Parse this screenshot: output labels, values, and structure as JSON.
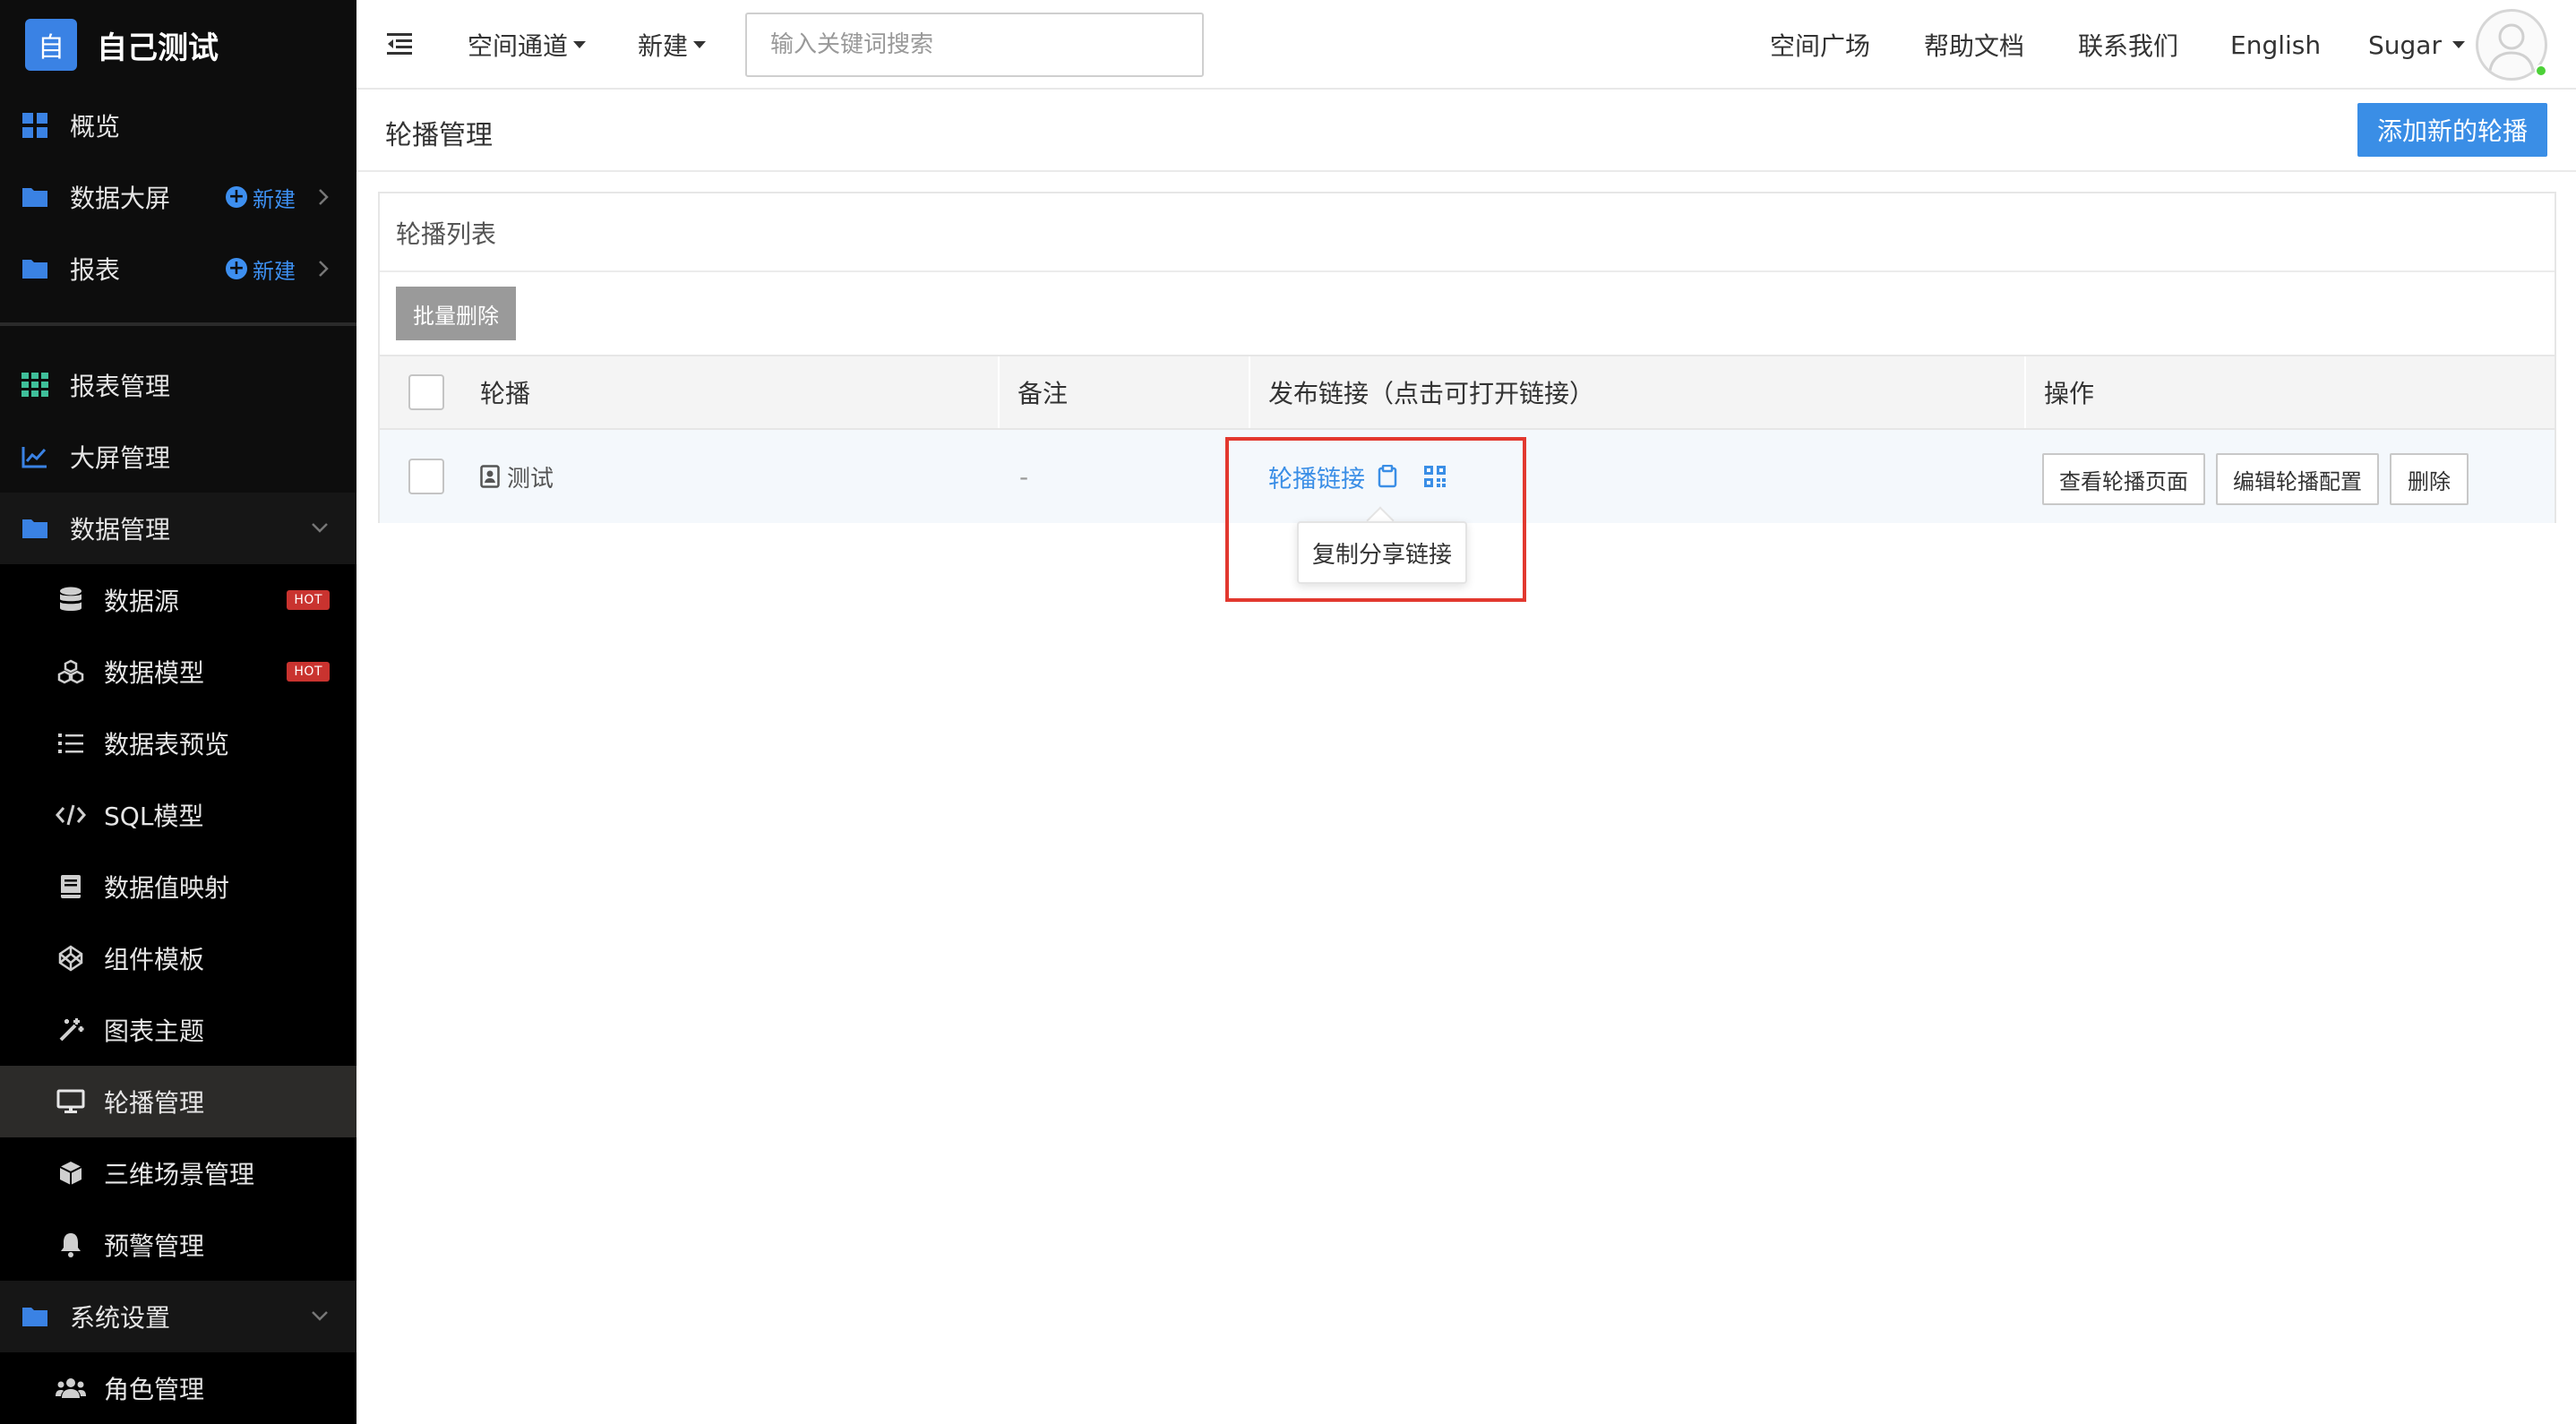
{
  "brand": {
    "logo_char": "自",
    "name": "自己测试"
  },
  "sidebar": {
    "items": [
      {
        "label": "概览",
        "icon": "grid-icon"
      },
      {
        "label": "数据大屏",
        "icon": "folder-icon",
        "new_label": "新建"
      },
      {
        "label": "报表",
        "icon": "folder-icon",
        "new_label": "新建"
      },
      {
        "label": "报表管理",
        "icon": "table-icon"
      },
      {
        "label": "大屏管理",
        "icon": "chart-line-icon"
      },
      {
        "label": "数据管理",
        "icon": "folder-icon"
      },
      {
        "label": "数据源",
        "icon": "database-icon",
        "badge": "HOT"
      },
      {
        "label": "数据模型",
        "icon": "cubes-icon",
        "badge": "HOT"
      },
      {
        "label": "数据表预览",
        "icon": "list-icon"
      },
      {
        "label": "SQL模型",
        "icon": "code-icon"
      },
      {
        "label": "数据值映射",
        "icon": "book-icon"
      },
      {
        "label": "组件模板",
        "icon": "codepen-icon"
      },
      {
        "label": "图表主题",
        "icon": "magic-wand-icon"
      },
      {
        "label": "轮播管理",
        "icon": "monitor-icon"
      },
      {
        "label": "三维场景管理",
        "icon": "cube-icon"
      },
      {
        "label": "预警管理",
        "icon": "bell-icon"
      },
      {
        "label": "系统设置",
        "icon": "folder-icon"
      },
      {
        "label": "角色管理",
        "icon": "users-icon"
      }
    ]
  },
  "topbar": {
    "space_channel": "空间通道",
    "new": "新建",
    "search_placeholder": "输入关键词搜索",
    "links": [
      "空间广场",
      "帮助文档",
      "联系我们",
      "English"
    ],
    "user": "Sugar"
  },
  "page": {
    "title": "轮播管理",
    "add_button": "添加新的轮播"
  },
  "panel": {
    "title": "轮播列表",
    "bulk_delete": "批量删除",
    "columns": [
      "轮播",
      "备注",
      "发布链接（点击可打开链接）",
      "操作"
    ],
    "rows": [
      {
        "name": "测试",
        "remark": "-",
        "link": "轮播链接",
        "actions": [
          "查看轮播页面",
          "编辑轮播配置",
          "删除"
        ]
      }
    ]
  },
  "tooltip": "复制分享链接",
  "colors": {
    "accent": "#3a8ee6",
    "sidebar_bg": "#0d0d0d",
    "hot_badge": "#c9332f",
    "highlight": "#e2382f"
  }
}
